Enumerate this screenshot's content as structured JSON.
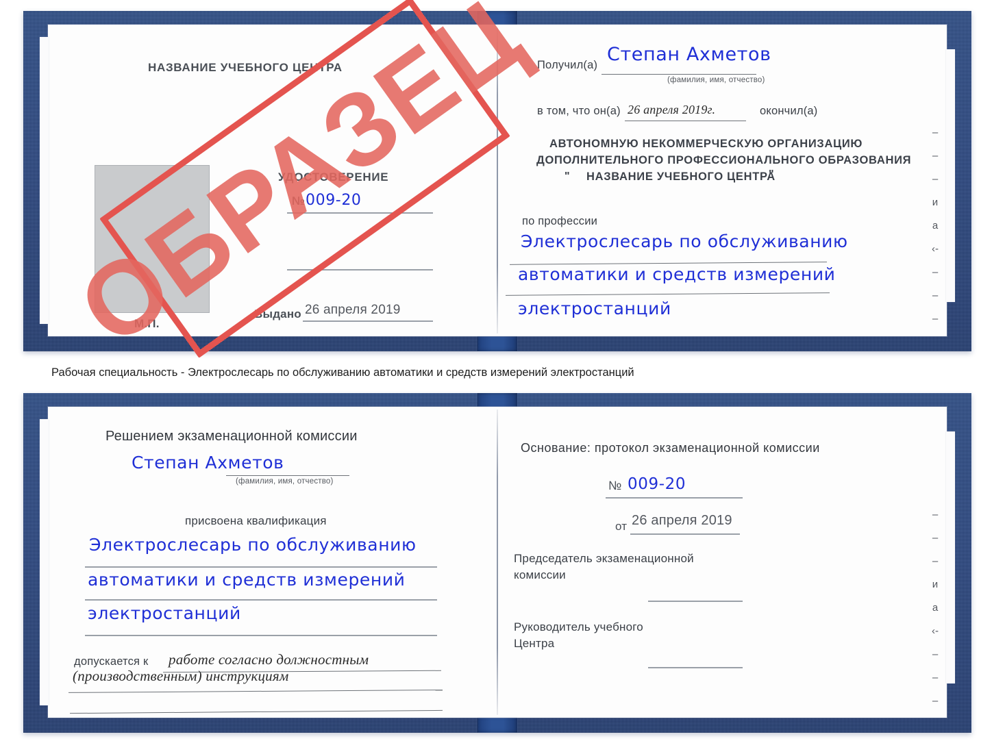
{
  "caption": {
    "text": "Рабочая специальность - Электрослесарь по обслуживанию автоматики и средств измерений электростанций"
  },
  "stamp": {
    "label": "ОБРАЗЕЦ",
    "color": "#e4675f",
    "border_color": "#e4544f"
  },
  "colors": {
    "cover_blue": "#2b4f90",
    "ink_blue": "#1f2fd6",
    "page_white": "#fdfdfd",
    "rule_grey": "#9aa0a8",
    "photo_grey": "#c9cbcd"
  },
  "certificate_top": {
    "left_page": {
      "org_title": "НАЗВАНИЕ УЧЕБНОГО ЦЕНТРА",
      "doc_type": "УДОСТОВЕРЕНИЕ",
      "number_label": "№",
      "number_value": "009-20",
      "issued_label": "Выдано",
      "issued_value": "26 апреля 2019",
      "seal_label": "М.П.",
      "photo_placeholder": "photo-placeholder"
    },
    "right_page": {
      "received_label": "Получил(а)",
      "received_value": "Степан Ахметов",
      "received_hint": "(фамилия, имя, отчество)",
      "in_that_label": "в том, что он(а)",
      "in_that_value": "26 апреля 2019г.",
      "finished_label": "окончил(а)",
      "org_line1": "АВТОНОМНУЮ НЕКОММЕРЧЕСКУЮ ОРГАНИЗАЦИЮ",
      "org_line2": "ДОПОЛНИТЕЛЬНОГО ПРОФЕССИОНАЛЬНОГО ОБРАЗОВАНИЯ",
      "org_line3_quote_open": "\"",
      "org_line3": "НАЗВАНИЕ УЧЕБНОГО ЦЕНТРА",
      "org_line3_quote_close": "\"",
      "profession_label": "по профессии",
      "profession_line1": "Электрослесарь по обслуживанию",
      "profession_line2": "автоматики и средств измерений",
      "profession_line3": "электростанций",
      "margin_artifacts": [
        "–",
        "–",
        "–",
        "и",
        "а",
        "‹-",
        "–",
        "–",
        "–",
        "–"
      ]
    }
  },
  "certificate_bottom": {
    "left_page": {
      "decision_title": "Решением экзаменационной комиссии",
      "person_name": "Степан Ахметов",
      "person_hint": "(фамилия, имя, отчество)",
      "qualification_label": "присвоена квалификация",
      "qualification_line1": "Электрослесарь по обслуживанию",
      "qualification_line2": "автоматики и средств измерений",
      "qualification_line3": "электростанций",
      "admitted_label": "допускается к",
      "admitted_line1": "работе согласно должностным",
      "admitted_line2": "(производственным) инструкциям"
    },
    "right_page": {
      "basis_label": "Основание: протокол экзаменационной комиссии",
      "protocol_number_label": "№",
      "protocol_number_value": "009-20",
      "protocol_date_label": "от",
      "protocol_date_value": "26 апреля 2019",
      "chairman_line1": "Председатель экзаменационной",
      "chairman_line2": "комиссии",
      "head_line1": "Руководитель учебного",
      "head_line2": "Центра",
      "margin_artifacts": [
        "–",
        "–",
        "–",
        "и",
        "а",
        "‹-",
        "–",
        "–",
        "–",
        "–"
      ]
    }
  }
}
